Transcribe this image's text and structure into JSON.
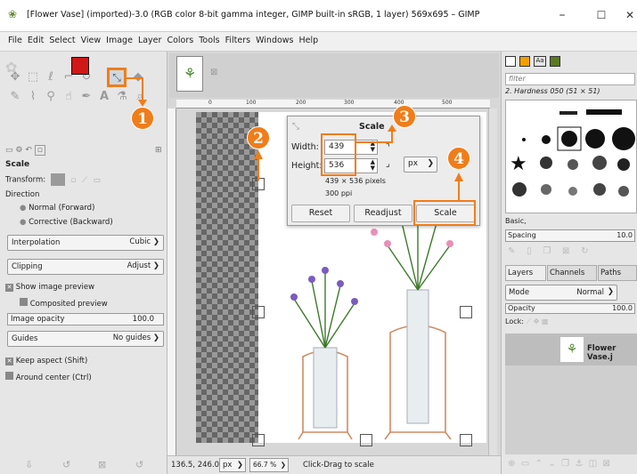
{
  "window": {
    "title": "[Flower Vase] (imported)-3.0 (RGB color 8-bit gamma integer, GIMP built-in sRGB, 1 layer) 569x695 – GIMP",
    "minimize_icon": "–",
    "maximize_icon": "☐",
    "close_icon": "✕"
  },
  "menu": [
    "File",
    "Edit",
    "Select",
    "View",
    "Image",
    "Layer",
    "Colors",
    "Tools",
    "Filters",
    "Windows",
    "Help"
  ],
  "tool_options": {
    "heading": "Scale",
    "transform_label": "Transform:",
    "direction_label": "Direction",
    "direction_normal": "Normal (Forward)",
    "direction_corrective": "Corrective (Backward)",
    "interpolation_label": "Interpolation",
    "interpolation_value": "Cubic",
    "clipping_label": "Clipping",
    "clipping_value": "Adjust",
    "show_preview": "Show image preview",
    "composited_preview": "Composited preview",
    "image_opacity_label": "Image opacity",
    "image_opacity_value": "100.0",
    "guides_label": "Guides",
    "guides_value": "No guides",
    "keep_aspect": "Keep aspect (Shift)",
    "around_center": "Around center (Ctrl)"
  },
  "ruler": [
    "0",
    "100",
    "200",
    "300",
    "400",
    "500"
  ],
  "scale_dialog": {
    "title": "Scale",
    "width_label": "Width:",
    "width_value": "439",
    "height_label": "Height:",
    "height_value": "536",
    "unit": "px",
    "size_info": "439 × 536 pixels",
    "resolution": "300 ppi",
    "reset": "Reset",
    "readjust": "Readjust",
    "scale": "Scale"
  },
  "callouts": [
    "1",
    "2",
    "3",
    "4"
  ],
  "status": {
    "coords": "136.5, 246.0",
    "unit": "px",
    "zoom": "66.7 %",
    "message": "Click-Drag to scale"
  },
  "brushes": {
    "filter_placeholder": "filter",
    "current_brush": "2. Hardness 050 (51 × 51)",
    "preset": "Basic,",
    "spacing_label": "Spacing",
    "spacing_value": "10.0"
  },
  "layers_panel": {
    "tabs": [
      "Layers",
      "Channels",
      "Paths"
    ],
    "mode_label": "Mode",
    "mode_value": "Normal",
    "opacity_label": "Opacity",
    "opacity_value": "100.0",
    "lock_label": "Lock:",
    "layer_name": "Flower Vase.j"
  },
  "colors": {
    "accent": "#f07d1a",
    "foreground": "#d01818",
    "background": "#ffffff"
  }
}
